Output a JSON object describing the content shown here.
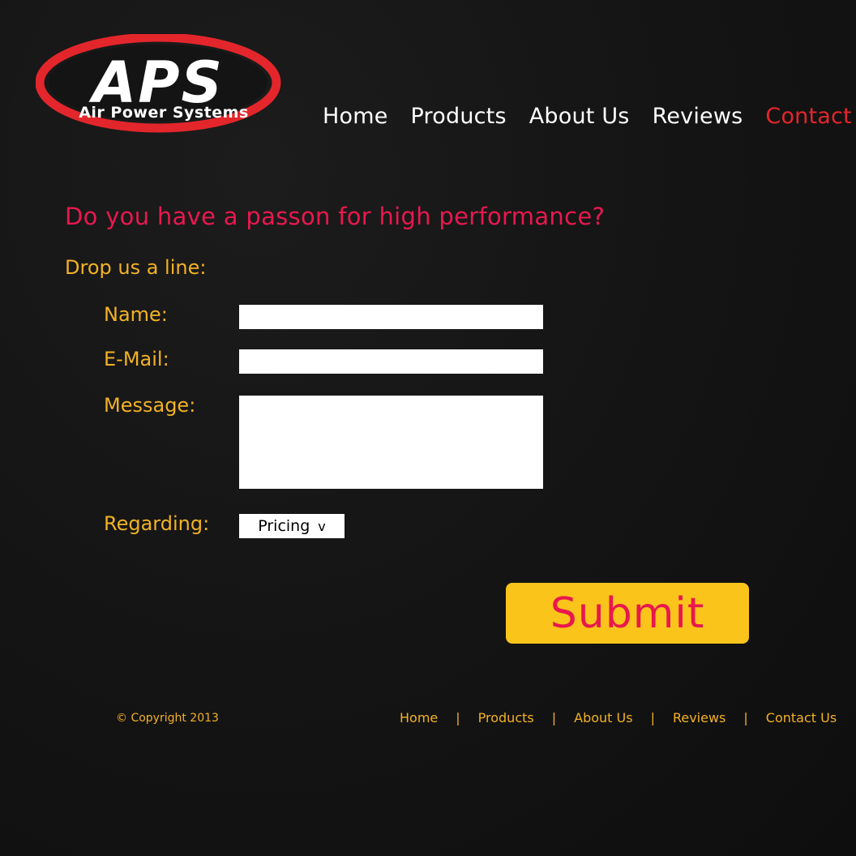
{
  "logo": {
    "letters": "APS",
    "tagline": "Air Power Systems",
    "ring_color": "#e3262b",
    "letter_color": "#ffffff"
  },
  "nav": {
    "items": [
      {
        "label": "Home"
      },
      {
        "label": "Products"
      },
      {
        "label": "About Us"
      },
      {
        "label": "Reviews"
      },
      {
        "label": "Contact Us",
        "active": true
      }
    ],
    "active_color": "#e3262b"
  },
  "content": {
    "headline": "Do you have a passon for high performance?",
    "subhead": "Drop us a line:"
  },
  "form": {
    "name_label": "Name:",
    "name_value": "",
    "email_label": "E-Mail:",
    "email_value": "",
    "message_label": "Message:",
    "message_value": "",
    "regarding_label": "Regarding:",
    "regarding_selected": "Pricing",
    "regarding_chevron": "v",
    "submit_label": "Submit"
  },
  "footer": {
    "copyright": "© Copyright 2013",
    "links": [
      {
        "label": "Home"
      },
      {
        "label": "Products"
      },
      {
        "label": "About Us"
      },
      {
        "label": "Reviews"
      },
      {
        "label": "Contact Us"
      }
    ],
    "separator": "|"
  },
  "colors": {
    "background": "#141414",
    "headline": "#e8184e",
    "accent_gold": "#f2b224",
    "button_bg": "#fbc41a",
    "button_text": "#e8184e"
  }
}
